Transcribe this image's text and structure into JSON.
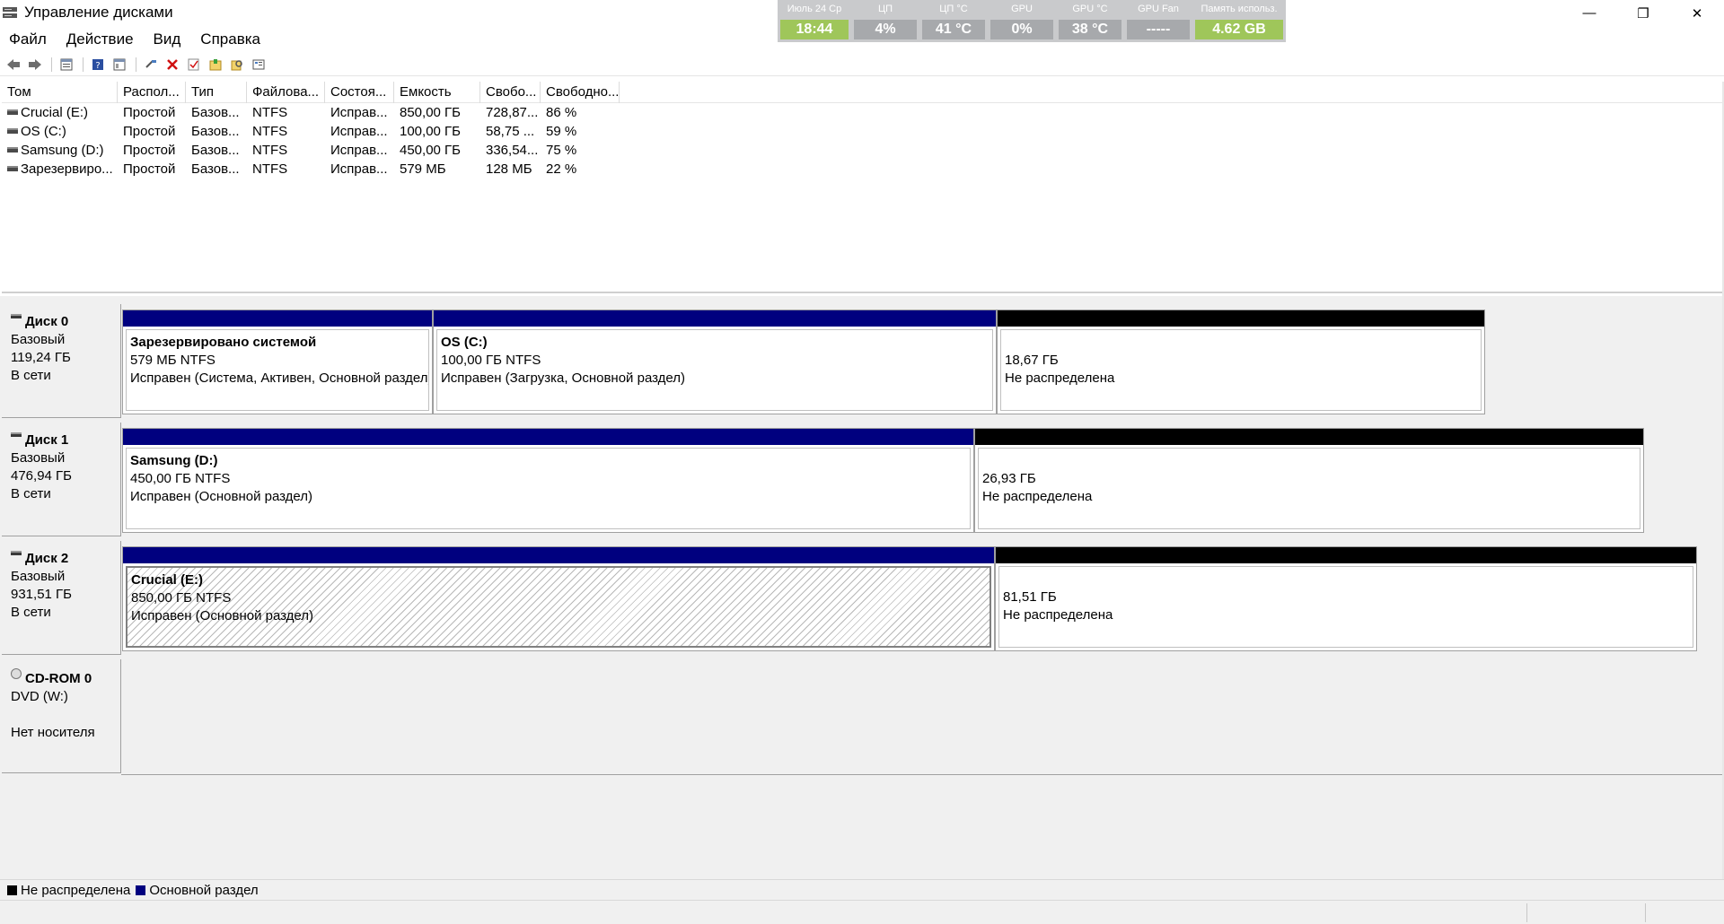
{
  "window": {
    "title": "Управление дисками",
    "minimize": "—",
    "restore": "❐",
    "close": "✕"
  },
  "hwmon": [
    {
      "label": "Июль 24  Ср",
      "value": "18:44",
      "color": "#9fc65a"
    },
    {
      "label": "ЦП",
      "value": "4%",
      "color": "#a7a9ac"
    },
    {
      "label": "ЦП °C",
      "value": "41 °C",
      "color": "#a7a9ac"
    },
    {
      "label": "GPU",
      "value": "0%",
      "color": "#a7a9ac"
    },
    {
      "label": "GPU °C",
      "value": "38 °C",
      "color": "#a7a9ac"
    },
    {
      "label": "GPU Fan",
      "value": "-----",
      "color": "#a7a9ac"
    },
    {
      "label": "Память использ.",
      "value": "4.62 GB",
      "color": "#9fc65a"
    }
  ],
  "menu": [
    "Файл",
    "Действие",
    "Вид",
    "Справка"
  ],
  "toolbar": {
    "icons": [
      "back-icon",
      "forward-icon",
      "properties-icon",
      "help-icon",
      "console-view-icon",
      "connect-icon",
      "delete-icon",
      "check-icon",
      "new-volume-icon",
      "search-icon",
      "settings-icon"
    ]
  },
  "volumes": {
    "columns": [
      "Том",
      "Распол...",
      "Тип",
      "Файлова...",
      "Состоя...",
      "Емкость",
      "Свобо...",
      "Свободно..."
    ],
    "rows": [
      [
        "Crucial (E:)",
        "Простой",
        "Базов...",
        "NTFS",
        "Исправ...",
        "850,00 ГБ",
        "728,87...",
        "86 %"
      ],
      [
        "OS (C:)",
        "Простой",
        "Базов...",
        "NTFS",
        "Исправ...",
        "100,00 ГБ",
        "58,75 ...",
        "59 %"
      ],
      [
        "Samsung (D:)",
        "Простой",
        "Базов...",
        "NTFS",
        "Исправ...",
        "450,00 ГБ",
        "336,54...",
        "75 %"
      ],
      [
        "Зарезервиро...",
        "Простой",
        "Базов...",
        "NTFS",
        "Исправ...",
        "579 МБ",
        "128 МБ",
        "22 %"
      ]
    ]
  },
  "disks": [
    {
      "name": "Диск 0",
      "type": "Базовый",
      "size": "119,24 ГБ",
      "state": "В сети",
      "partitions": [
        {
          "name": "Зарезервировано системой",
          "size": "579 МБ NTFS",
          "status": "Исправен (Система, Активен, Основной раздел)"
        },
        {
          "name": "OS  (C:)",
          "size": "100,00 ГБ NTFS",
          "status": "Исправен (Загрузка, Основной раздел)"
        },
        {
          "name": "",
          "size": "18,67 ГБ",
          "status": "Не распределена"
        }
      ]
    },
    {
      "name": "Диск 1",
      "type": "Базовый",
      "size": "476,94 ГБ",
      "state": "В сети",
      "partitions": [
        {
          "name": "Samsung  (D:)",
          "size": "450,00 ГБ NTFS",
          "status": "Исправен (Основной раздел)"
        },
        {
          "name": "",
          "size": "26,93 ГБ",
          "status": "Не распределена"
        }
      ]
    },
    {
      "name": "Диск 2",
      "type": "Базовый",
      "size": "931,51 ГБ",
      "state": "В сети",
      "partitions": [
        {
          "name": "Crucial  (E:)",
          "size": "850,00 ГБ NTFS",
          "status": "Исправен (Основной раздел)"
        },
        {
          "name": "",
          "size": "81,51 ГБ",
          "status": "Не распределена"
        }
      ]
    }
  ],
  "cdrom": {
    "name": "CD-ROM 0",
    "drive": "DVD (W:)",
    "media": "Нет носителя"
  },
  "legend": [
    {
      "label": "Не распределена",
      "color": "#000000"
    },
    {
      "label": "Основной раздел",
      "color": "#00007f"
    }
  ]
}
